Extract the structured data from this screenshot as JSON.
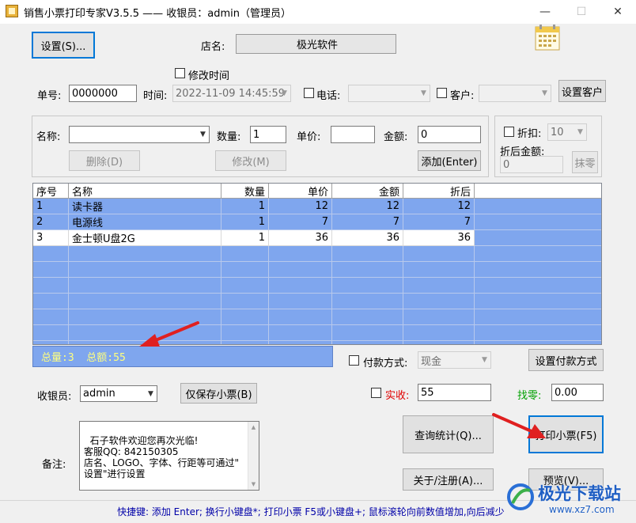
{
  "window": {
    "title": "销售小票打印专家V3.5.5 —— 收银员：admin（管理员）",
    "minimize": "—",
    "maximize": "☐",
    "close": "✕"
  },
  "top": {
    "settings_button": "设置(S)...",
    "shop_label": "店名:",
    "shop_name": "极光软件",
    "modify_time_label": "修改时间",
    "order_label": "单号:",
    "order_value": "0000000",
    "time_label": "时间:",
    "time_value": "2022-11-09 14:45:59",
    "phone_label": "电话:",
    "customer_label": "客户:",
    "set_customer_button": "设置客户"
  },
  "item_entry": {
    "name_label": "名称:",
    "name_value": "",
    "qty_label": "数量:",
    "qty_value": "1",
    "price_label": "单价:",
    "price_value": "",
    "amount_label": "金额:",
    "amount_value": "0",
    "delete_button": "删除(D)",
    "modify_button": "修改(M)",
    "add_button": "添加(Enter)"
  },
  "discount": {
    "discount_label": "折扣:",
    "discount_value": "10",
    "after_discount_label": "折后金额:",
    "after_discount_value": "0",
    "round_button": "抹零"
  },
  "table": {
    "columns": [
      "序号",
      "名称",
      "数量",
      "单价",
      "金额",
      "折后"
    ],
    "rows": [
      [
        "1",
        "读卡器",
        "1",
        "12",
        "12",
        "12"
      ],
      [
        "2",
        "电源线",
        "1",
        "7",
        "7",
        "7"
      ],
      [
        "3",
        "金士顿U盘2G",
        "1",
        "36",
        "36",
        "36"
      ]
    ]
  },
  "summary": {
    "text": "总量:3  总额:55"
  },
  "payment": {
    "method_label": "付款方式:",
    "method_value": "现金",
    "set_method_button": "设置付款方式",
    "cashier_label": "收银员:",
    "cashier_value": "admin",
    "save_only_button": "仅保存小票(B)",
    "received_label": "实收:",
    "received_value": "55",
    "change_label": "找零:",
    "change_value": "0.00"
  },
  "notes": {
    "label": "备注:",
    "text": "石子软件欢迎您再次光临!\n客服QQ: 842150305\n店名、LOGO、字体、行距等可通过\"\n设置\"进行设置"
  },
  "actions": {
    "query_button": "查询统计(Q)...",
    "print_button": "打印小票(F5)",
    "about_button": "关于/注册(A)...",
    "preview_button": "预览(V)..."
  },
  "status": {
    "text": "快捷键: 添加 Enter; 换行小键盘*; 打印小票 F5或小键盘+; 鼠标滚轮向前数值增加,向后减少"
  },
  "watermark": {
    "text": "极光下载站",
    "url": "www.xz7.com"
  },
  "colors": {
    "grid_blue": "#7fa6ee",
    "summary_text": "#ffff7f",
    "received_red": "#e00000",
    "change_green": "#00a000",
    "status_blue": "#0000a8",
    "arrow_red": "#e02020"
  }
}
